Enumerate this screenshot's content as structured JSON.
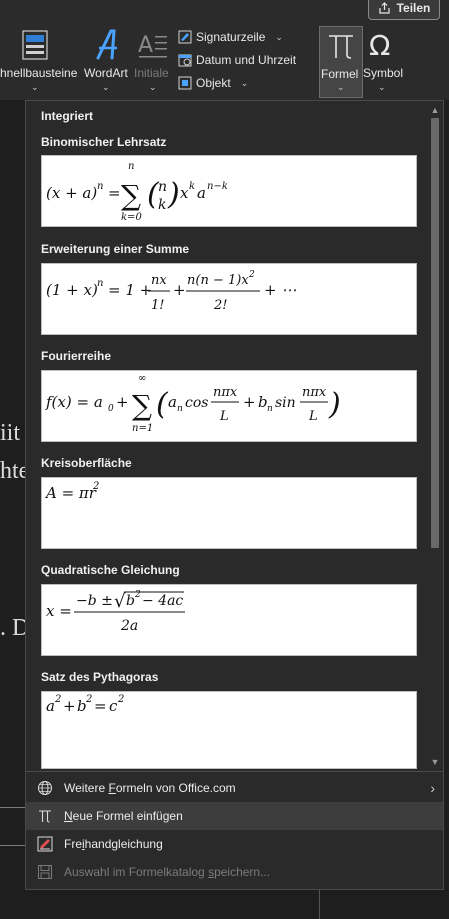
{
  "ribbon": {
    "share": "Teilen",
    "quick_parts": "hnellbausteine",
    "wordart": "WordArt",
    "initiale": "Initiale",
    "signature_line": "Signaturzeile",
    "date_time": "Datum und Uhrzeit",
    "object": "Objekt",
    "formel": "Formel",
    "symbol": "Symbol"
  },
  "document": {
    "line1": "iit",
    "line2": "hte",
    "line3": ". D"
  },
  "panel": {
    "header": "Integriert",
    "equations": [
      {
        "title": "Binomischer Lehrsatz"
      },
      {
        "title": "Erweiterung einer Summe"
      },
      {
        "title": "Fourierreihe"
      },
      {
        "title": "Kreisoberfläche"
      },
      {
        "title": "Quadratische Gleichung"
      },
      {
        "title": "Satz des Pythagoras"
      }
    ],
    "menu": [
      {
        "pre": "Weitere ",
        "ul": "F",
        "post": "ormeln von Office.com"
      },
      {
        "pre": "",
        "ul": "N",
        "post": "eue Formel einfügen"
      },
      {
        "pre": "Fre",
        "ul": "i",
        "post": "handgleichung"
      },
      {
        "pre": "Auswahl im Formelkatalog ",
        "ul": "s",
        "post": "peichern..."
      }
    ]
  },
  "colors": {
    "accent_wordart": "#4aa3ff",
    "hover_row": "#3d3d3d"
  }
}
